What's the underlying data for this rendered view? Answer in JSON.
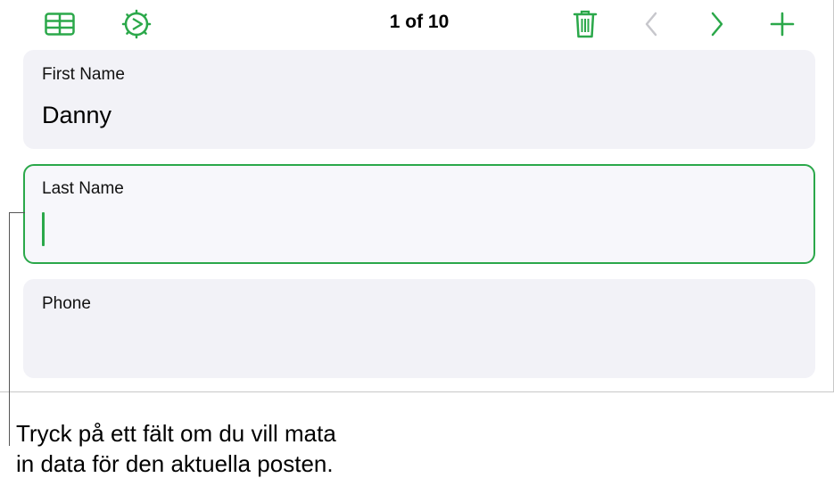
{
  "colors": {
    "accent": "#2ba84a",
    "disabled": "#c7c7cc",
    "field_background": "#f2f2f7"
  },
  "toolbar": {
    "icons": {
      "table": "table-icon",
      "format": "format-icon",
      "delete": "trash-icon",
      "previous": "chevron-left-icon",
      "next": "chevron-right-icon",
      "add": "plus-icon"
    },
    "record_counter": "1 of 10"
  },
  "fields": [
    {
      "label": "First Name",
      "value": "Danny"
    },
    {
      "label": "Last Name",
      "value": ""
    },
    {
      "label": "Phone",
      "value": ""
    }
  ],
  "callout": {
    "line1": "Tryck på ett fält om du vill mata",
    "line2": "in data för den aktuella posten."
  }
}
